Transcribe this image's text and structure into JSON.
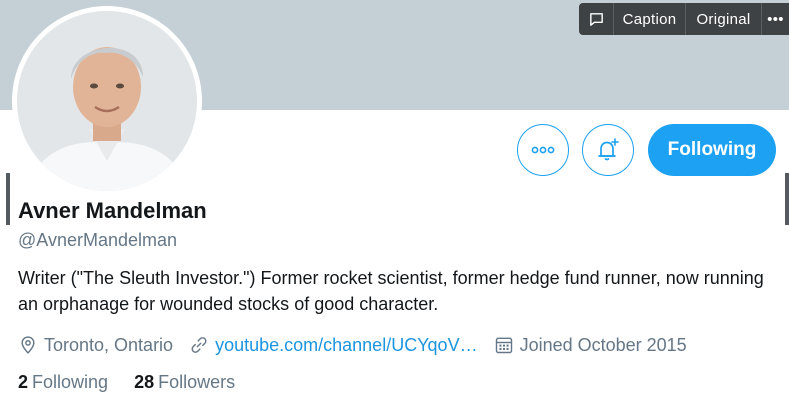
{
  "overlay": {
    "caption_label": "Caption",
    "original_label": "Original",
    "more_label": "•••"
  },
  "profile": {
    "name": "Avner Mandelman",
    "handle": "@AvnerMandelman",
    "bio": "Writer (\"The Sleuth Investor.\") Former rocket scientist, former hedge fund runner, now running an orphanage for wounded stocks of good character.",
    "location": "Toronto, Ontario",
    "website": "youtube.com/channel/UCYqoV…",
    "joined": "Joined October 2015"
  },
  "actions": {
    "more_icon": "more-horizontal-icon",
    "notify_icon": "bell-plus-icon",
    "following_label": "Following"
  },
  "stats": {
    "following_count": "2",
    "following_label": "Following",
    "followers_count": "28",
    "followers_label": "Followers"
  },
  "colors": {
    "accent": "#1da1f2",
    "link": "#1b95e0",
    "secondary_text": "#657786",
    "banner": "#c4cfd6"
  }
}
